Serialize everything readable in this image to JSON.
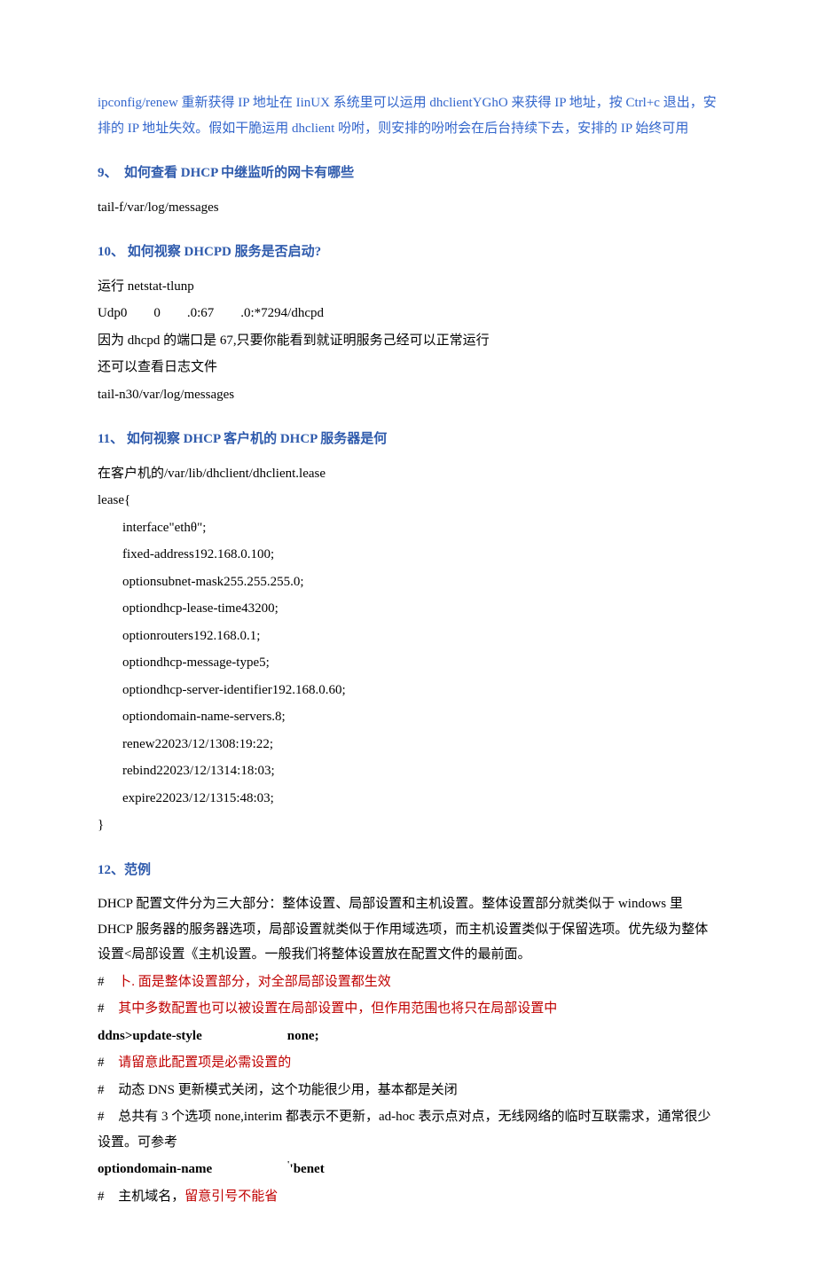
{
  "intro": {
    "part1": "ipconfig/renew 重新获得 IP 地址在 IinUX 系统里可以运用 dhclientYGhO 来获得 IP 地址，",
    "part2": "按 Ctrl+c 退出，安排的 IP 地址失效。假如干脆运用 dhclient 吩咐，则安排的吩咐会在后台持续下去，安排的 IP 始终可用"
  },
  "h9": "9、　如何查看 DHCP 中继监听的网卡有哪些",
  "s9_l1": "tail-f/var/log/messages",
  "h10": "10、 如何视察 DHCPD 服务是否启动?",
  "s10_l1": "运行 netstat-tlunp",
  "s10_l2": "Udp0　　0　　.0:67　　.0:*7294/dhcpd",
  "s10_l3": "因为 dhcpd 的端口是 67,只要你能看到就证明服务己经可以正常运行",
  "s10_l4": "还可以查看日志文件",
  "s10_l5": "tail-n30/var/log/messages",
  "h11": "11、 如何视察 DHCP 客户机的 DHCP 服务器是何",
  "s11_l1": "在客户机的/var/lib/dhclient/dhclient.lease",
  "s11_l2": "lease{",
  "s11_l3": "interface\"ethθ\";",
  "s11_l4": "fixed-address192.168.0.100;",
  "s11_l5": "optionsubnet-mask255.255.255.0;",
  "s11_l6": "optiondhcp-lease-time43200;",
  "s11_l7": "optionrouters192.168.0.1;",
  "s11_l8": "optiondhcp-message-type5;",
  "s11_l9": "optiondhcp-server-identifier192.168.0.60;",
  "s11_l10": "optiondomain-name-servers.8;",
  "s11_l11": "renew22023/12/1308:19:22;",
  "s11_l12": "rebind22023/12/1314:18:03;",
  "s11_l13": "expire22023/12/1315:48:03;",
  "s11_l14": "}",
  "h12": "12、范例",
  "s12_p1": "DHCP 配置文件分为三大部分：整体设置、局部设置和主机设置。整体设置部分就类似于 windows 里 DHCP 服务器的服务器选项，局部设置就类似于作用域选项，而主机设置类似于保留选项。优先级为整体设置<局部设置《主机设置。一般我们将整体设置放在配置文件的最前面。",
  "s12_hash1a": "#",
  "s12_hash1b": "卜. 面是整体设置部分，对全部局部设置都生效",
  "s12_hash2a": "#",
  "s12_hash2b": "其中多数配置也可以被设置在局部设置中，但作用范围也将只在局部设置中",
  "s12_cfg1_k": "ddns>update-style",
  "s12_cfg1_v": "none;",
  "s12_hash3a": "#",
  "s12_hash3b": "请留意此配置项是必需设置的",
  "s12_hash4a": "#",
  "s12_hash4b": "动态 DNS 更新模式关闭，这个功能很少用，基本都是关闭",
  "s12_hash5a": "#",
  "s12_hash5b": "总共有 3 个选项 none,interim 都表示不更新，ad-hoc 表示点对点，无线网络的临时互联需求，通常很少设置。可参考",
  "s12_cfg2_k": "optiondomain-name",
  "s12_cfg2_v": "'",
  "s12_cfg2_v2": "'benet",
  "s12_hash6a": "#",
  "s12_hash6b": "主机域名，",
  "s12_hash6c": "留意引号不能省"
}
